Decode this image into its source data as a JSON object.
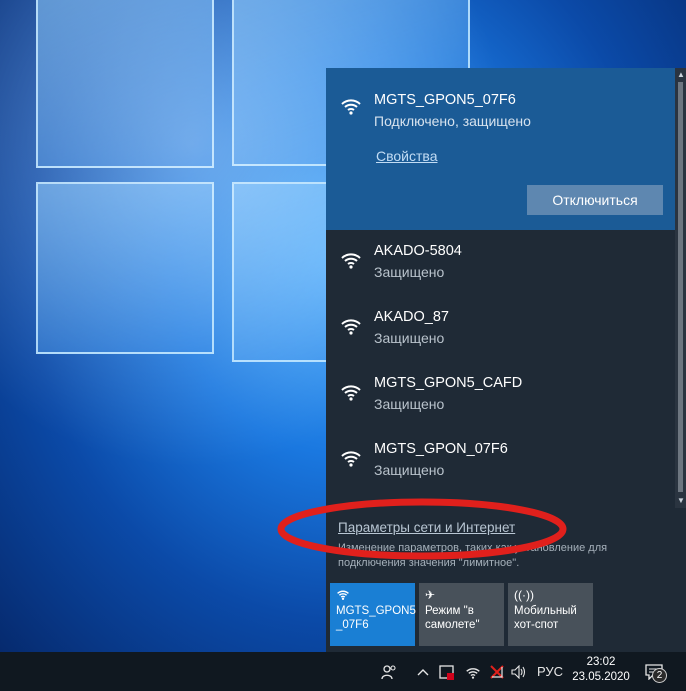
{
  "active_network": {
    "ssid": "MGTS_GPON5_07F6",
    "status": "Подключено, защищено",
    "properties_link": "Свойства",
    "disconnect_label": "Отключиться"
  },
  "networks": [
    {
      "ssid": "AKADO-5804",
      "status": "Защищено"
    },
    {
      "ssid": "AKADO_87",
      "status": "Защищено"
    },
    {
      "ssid": "MGTS_GPON5_CAFD",
      "status": "Защищено"
    },
    {
      "ssid": "MGTS_GPON_07F6",
      "status": "Защищено"
    }
  ],
  "settings": {
    "link": "Параметры сети и Интернет",
    "description": "Изменение параметров, таких как установление для подключения значения \"лимитное\"."
  },
  "quick_actions": [
    {
      "line1": "MGTS_GPON5",
      "line2": "_07F6",
      "icon": "wifi-icon",
      "state": "on"
    },
    {
      "line1": "Режим \"в",
      "line2": "самолете\"",
      "icon": "airplane-icon",
      "state": "off"
    },
    {
      "line1": "Мобильный",
      "line2": "хот-спот",
      "icon": "hotspot-icon",
      "state": "off"
    }
  ],
  "taskbar": {
    "language": "РУС",
    "time": "23:02",
    "date": "23.05.2020",
    "notification_count": "2"
  },
  "colors": {
    "flyout_bg": "#1f2a36",
    "active_bg": "#1b5b96",
    "accent": "#1a7fd4",
    "annotation": "#e0201c"
  }
}
